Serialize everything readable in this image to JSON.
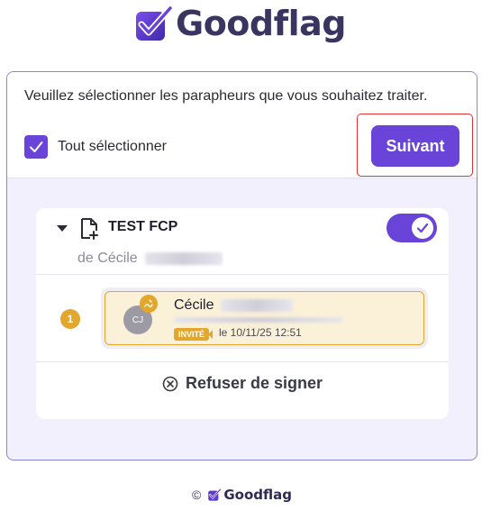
{
  "brand": {
    "name": "Goodflag",
    "accent": "#6a43d9",
    "logo_icon": "check-shield-icon"
  },
  "selection": {
    "instruction": "Veuillez sélectionner les parapheurs que vous souhaitez traiter.",
    "select_all_label": "Tout sélectionner",
    "select_all_checked": true,
    "next_label": "Suivant"
  },
  "parapheur": {
    "title": "TEST FCP",
    "from_prefix": "de Cécile",
    "enabled": true,
    "signers": [
      {
        "step": "1",
        "initials": "CJ",
        "name": "Cécile",
        "status": "INVITÉ",
        "date": "le 10/11/25 12:51",
        "status_color": "#e2a72c"
      }
    ],
    "refuse_label": "Refuser de signer"
  },
  "footer": {
    "copyright": "©",
    "brand": "Goodflag"
  }
}
